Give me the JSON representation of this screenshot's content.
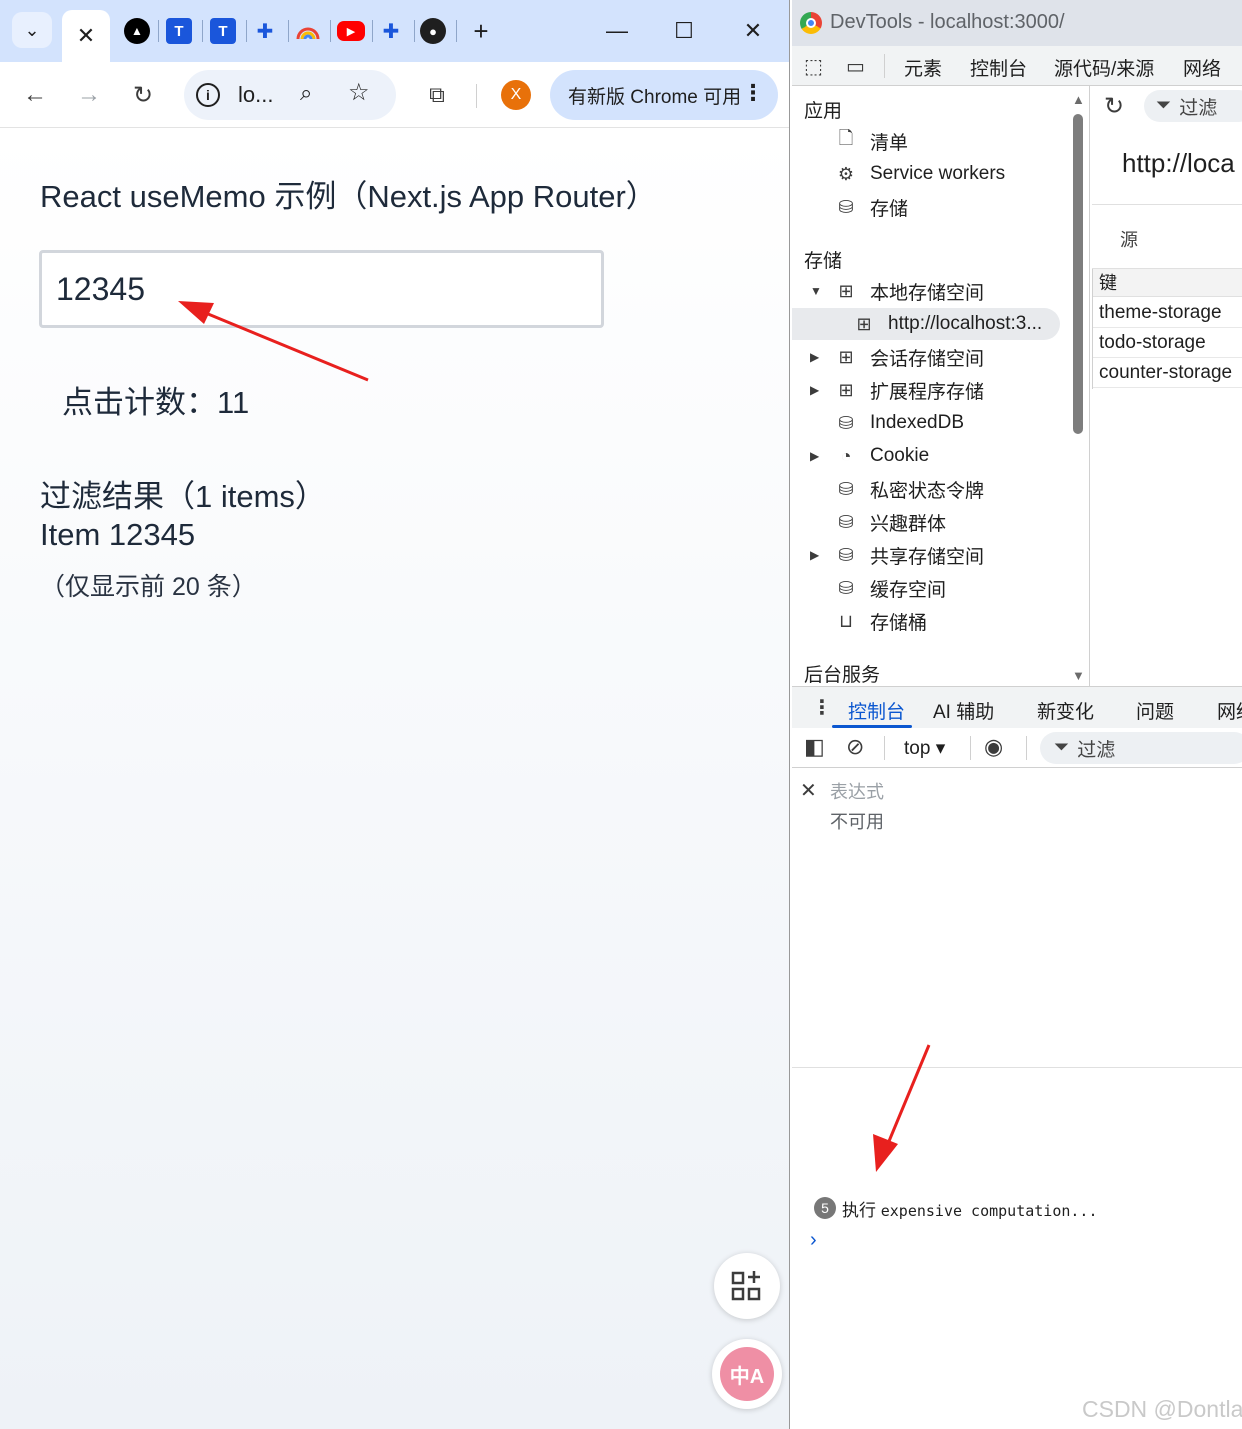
{
  "browser": {
    "tabs": [
      {
        "icon": "caret-down-icon"
      },
      {
        "icon": "close-icon",
        "active": true
      },
      {
        "icon": "vercel-icon"
      },
      {
        "icon": "t-icon"
      },
      {
        "icon": "t-icon"
      },
      {
        "icon": "puzzle-icon"
      },
      {
        "icon": "rainbow-icon"
      },
      {
        "icon": "youtube-icon"
      },
      {
        "icon": "puzzle-icon"
      },
      {
        "icon": "github-icon"
      }
    ],
    "url_short": "lo...",
    "update_label": "有新版 Chrome 可用",
    "profile_initial": "X",
    "colors": {
      "tabstrip": "#d3e3fd",
      "profile": "#e8710a",
      "accent": "#0b57d0"
    }
  },
  "page": {
    "title": "React useMemo 示例（Next.js App Router）",
    "input_value": "12345",
    "click_count": "点击计数：11",
    "filter_heading": "过滤结果（1 items）",
    "filter_item": "Item 12345",
    "filter_note": "（仅显示前 20 条）",
    "translate_label": "中A"
  },
  "devtools": {
    "title": "DevTools - localhost:3000/",
    "tabs": [
      "元素",
      "控制台",
      "源代码/来源",
      "网络"
    ],
    "sidebar": {
      "app_section": "应用",
      "app_items": [
        "清单",
        "Service workers",
        "存储"
      ],
      "storage_section": "存储",
      "storage_items": [
        {
          "label": "本地存储空间",
          "expanded": true
        },
        {
          "label": "http://localhost:3..."
        },
        {
          "label": "会话存储空间"
        },
        {
          "label": "扩展程序存储"
        },
        {
          "label": "IndexedDB"
        },
        {
          "label": "Cookie"
        },
        {
          "label": "私密状态令牌"
        },
        {
          "label": "兴趣群体"
        },
        {
          "label": "共享存储空间"
        },
        {
          "label": "缓存空间"
        },
        {
          "label": "存储桶"
        }
      ],
      "bg_section": "后台服务"
    },
    "storage_view": {
      "filter": "过滤",
      "origin": "http://loca",
      "source_label": "源",
      "key_header": "键",
      "keys": [
        "theme-storage",
        "todo-storage",
        "counter-storage"
      ]
    },
    "drawer_tabs": [
      "控制台",
      "AI 辅助",
      "新变化",
      "问题",
      "网络"
    ],
    "console": {
      "context": "top ▾",
      "filter": "过滤",
      "expression_label": "表达式",
      "expression_value": "不可用",
      "log_count": "5",
      "log_prefix": "执行 ",
      "log_text": "expensive computation..."
    }
  },
  "watermark": "CSDN @Dontla"
}
